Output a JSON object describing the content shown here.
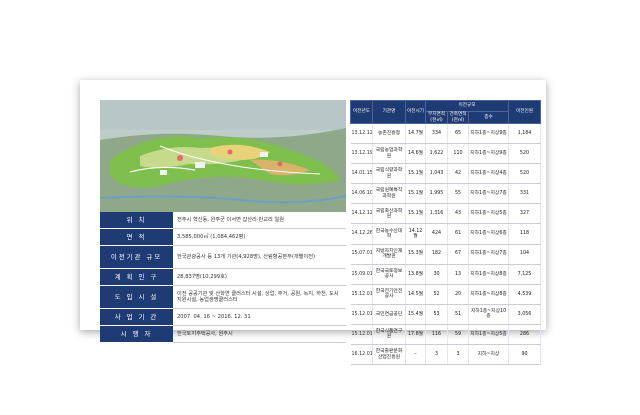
{
  "summary": [
    {
      "label": "위      치",
      "value": "전주시 혁신동, 완주군 이서면 갑산리·반교리 일원"
    },
    {
      "label": "면      적",
      "value": "3,585,000㎡ (1,084,462평)"
    },
    {
      "label": "이전기관 규모",
      "value": "한국관광공사 등 13개 기관(4,928명), 산림항공본부(개별이전)"
    },
    {
      "label": "계 획 인 구",
      "value": "28,837명(10,299호)"
    },
    {
      "label": "도 입 시 설",
      "value": "이전 공공기관 및 산학연 클러스터 시설, 상업, 주거, 공원, 녹지, 하천, 도시지원시설, 농업생명클러스터"
    },
    {
      "label": "사 업 기 간",
      "value": "2007. 04. 16 ~ 2016. 12. 31"
    },
    {
      "label": "시  행  자",
      "value": "한국토지주택공사, 원주시"
    }
  ],
  "table": {
    "headers": {
      "date": "이전년도",
      "org": "기관명",
      "timing": "이전시기",
      "scale": "이전규모",
      "land": "부지면적 (천㎡)",
      "building": "건축면적 (천㎡)",
      "floors": "층수",
      "staff": "이전인원"
    },
    "rows": [
      {
        "date": "13.12.12",
        "org": "농촌진흥청",
        "timing": "14.7월",
        "land": "334",
        "building": "65",
        "floors": "지하1층~지상9층",
        "staff": "1,184"
      },
      {
        "date": "13.12.19",
        "org": "국립농업과학원",
        "timing": "14.6월",
        "land": "1,622",
        "building": "110",
        "floors": "지하1층~지상9층",
        "staff": "520"
      },
      {
        "date": "14.01.15",
        "org": "국립식량과학원",
        "timing": "15.1월",
        "land": "1,043",
        "building": "42",
        "floors": "지하1층~지상4층",
        "staff": "520"
      },
      {
        "date": "14.06.10",
        "org": "국립원예특작과학원",
        "timing": "15.1월",
        "land": "1,995",
        "building": "55",
        "floors": "지하1층~지상7층",
        "staff": "331"
      },
      {
        "date": "14.12.12",
        "org": "국립축산과학원",
        "timing": "15.1월",
        "land": "1,316",
        "building": "43",
        "floors": "지하1층~지상5층",
        "staff": "327"
      },
      {
        "date": "14.12.26",
        "org": "한국농수산대학",
        "timing": "14.12월",
        "land": "424",
        "building": "61",
        "floors": "지하1층~지상6층",
        "staff": "118"
      },
      {
        "date": "15.07.01",
        "org": "지방자치인재개발원",
        "timing": "15.3월",
        "land": "182",
        "building": "67",
        "floors": "지하1층~지상7층",
        "staff": "104"
      },
      {
        "date": "15.09.01",
        "org": "한국국토정보공사",
        "timing": "13.8월",
        "land": "30",
        "building": "13",
        "floors": "지하1층~지상8층",
        "staff": "7,125"
      },
      {
        "date": "15.12.01",
        "org": "한국전기안전공사",
        "timing": "14.5월",
        "land": "52",
        "building": "20",
        "floors": "지하1층~지상8층",
        "staff": "4,539"
      },
      {
        "date": "15.12.01",
        "org": "국민연금공단",
        "timing": "15.4월",
        "land": "53",
        "building": "51",
        "floors": "지하1층~지상10층",
        "staff": "3,056"
      },
      {
        "date": "15.12.01",
        "org": "한국식품연구원",
        "timing": "17.8월",
        "land": "116",
        "building": "59",
        "floors": "지하1층~지상5층",
        "staff": "286"
      },
      {
        "date": "16.12.01",
        "org": "한국출판문화산업진흥원",
        "timing": "–",
        "land": "3",
        "building": "3",
        "floors": "지하~지상",
        "staff": "90"
      }
    ]
  }
}
